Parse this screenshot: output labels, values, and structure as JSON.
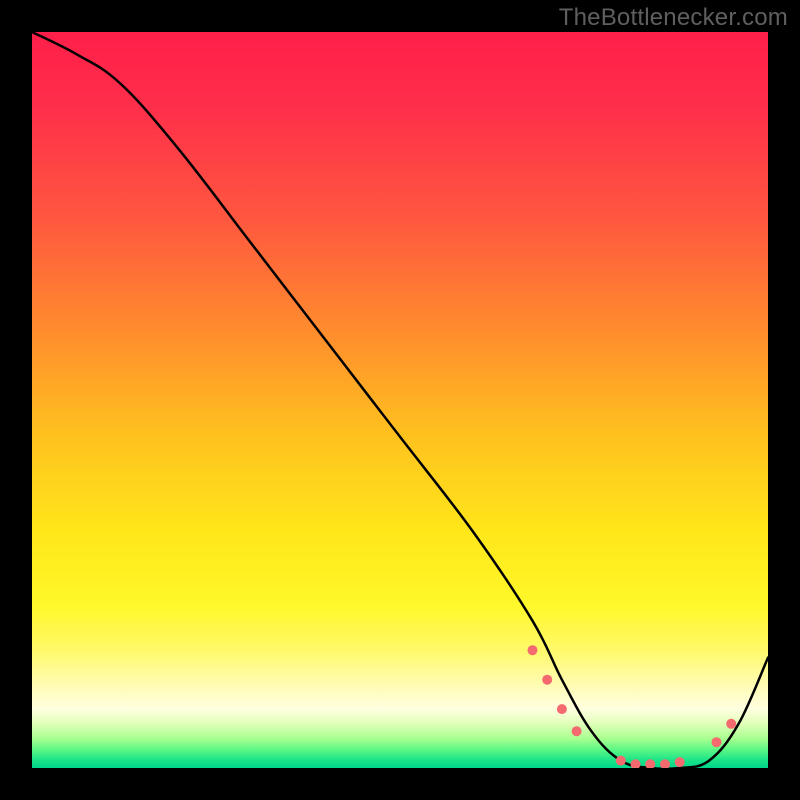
{
  "watermark": "TheBottlenecker.com",
  "chart_data": {
    "type": "line",
    "title": "",
    "xlabel": "",
    "ylabel": "",
    "xlim": [
      0,
      100
    ],
    "ylim": [
      0,
      100
    ],
    "x": [
      0,
      6,
      12,
      20,
      30,
      40,
      50,
      60,
      68,
      72,
      76,
      80,
      84,
      88,
      92,
      96,
      100
    ],
    "values": [
      100,
      97,
      93,
      84,
      71,
      58,
      45,
      32,
      20,
      12,
      5,
      1,
      0,
      0,
      1,
      6,
      15
    ],
    "markers": {
      "x": [
        68,
        70,
        72,
        74,
        80,
        82,
        84,
        86,
        88,
        93,
        95
      ],
      "y": [
        16,
        12,
        8,
        5,
        1,
        0.5,
        0.5,
        0.5,
        0.8,
        3.5,
        6
      ],
      "color": "#f46a6f",
      "size": 10
    },
    "line_color": "#000000",
    "gradient": [
      "#ff1f4a",
      "#ffe71a",
      "#00d68c"
    ]
  }
}
